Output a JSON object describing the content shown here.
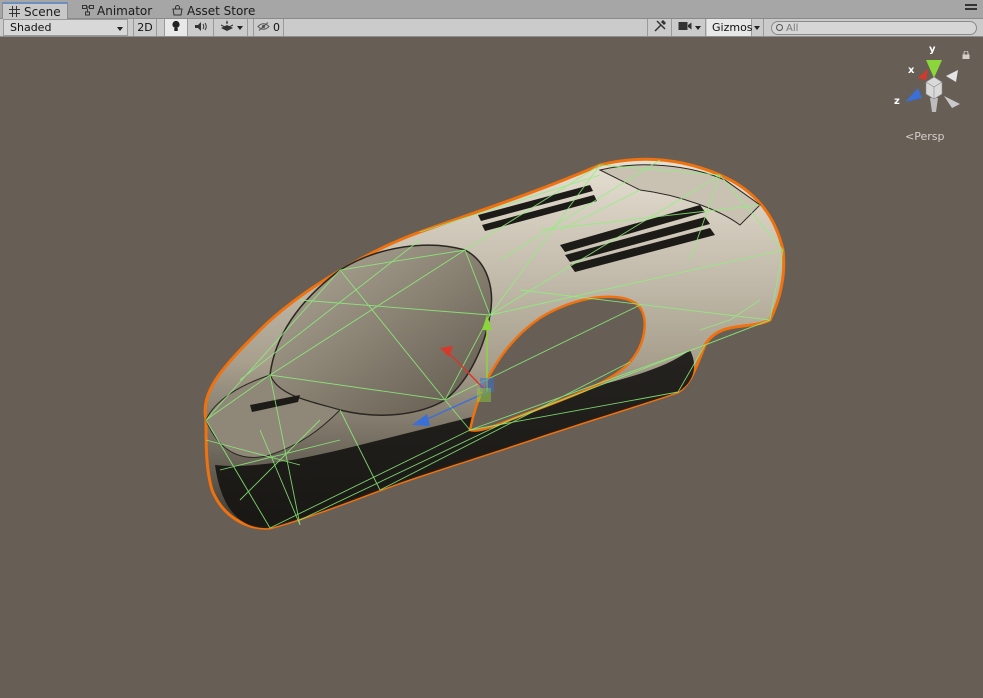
{
  "tabs": [
    {
      "label": "Scene",
      "icon": "grid-icon",
      "active": true
    },
    {
      "label": "Animator",
      "icon": "animator-icon",
      "active": false
    },
    {
      "label": "Asset Store",
      "icon": "store-icon",
      "active": false
    }
  ],
  "toolbar": {
    "draw_mode": "Shaded",
    "mode_2d": "2D",
    "hidden_count": "0",
    "gizmos_label": "Gizmos",
    "search_placeholder": "All"
  },
  "scene": {
    "projection_label": "Persp",
    "axis_labels": {
      "x": "x",
      "y": "y",
      "z": "z"
    },
    "colors": {
      "background": "#675e56",
      "selection_outline": "#f0720f",
      "wireframe": "#8cf27a",
      "axis_x": "#d8382a",
      "axis_y": "#8bd63a",
      "axis_z": "#3a6fd8"
    }
  }
}
